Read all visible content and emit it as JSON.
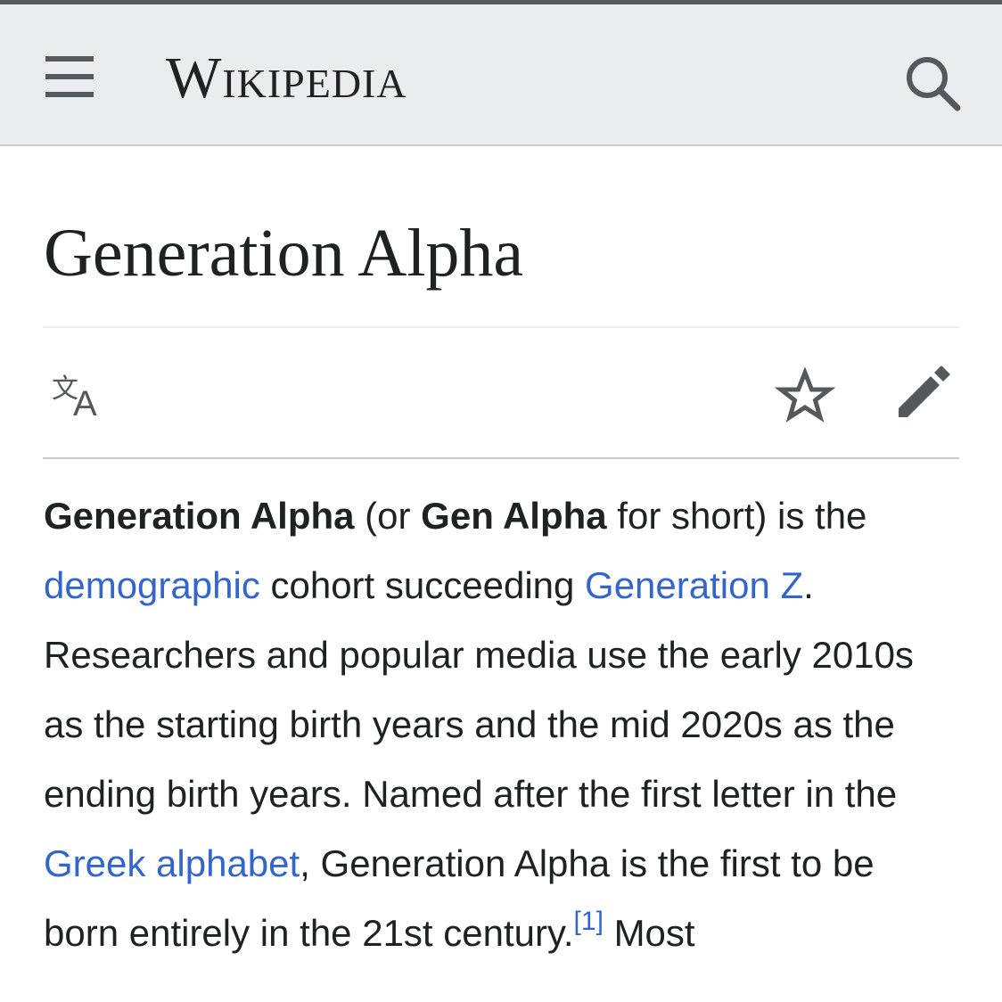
{
  "header": {
    "menu_icon": "hamburger-menu-icon",
    "wordmark": "Wikipedia",
    "search_icon": "search-icon"
  },
  "page": {
    "title": "Generation Alpha",
    "actions": {
      "language_icon": "language-icon",
      "watch_icon": "star-icon",
      "edit_icon": "pencil-icon"
    }
  },
  "article": {
    "segments": [
      {
        "type": "bold",
        "text": "Generation Alpha"
      },
      {
        "type": "text",
        "text": " (or "
      },
      {
        "type": "bold",
        "text": "Gen Alpha"
      },
      {
        "type": "text",
        "text": " for short) is the "
      },
      {
        "type": "link",
        "text": "demographic"
      },
      {
        "type": "text",
        "text": " cohort succeeding "
      },
      {
        "type": "link",
        "text": "Generation Z"
      },
      {
        "type": "text",
        "text": ". Researchers and popular media use the early 2010s as the starting birth years and the mid 2020s as the ending birth years. Named after the first letter in the "
      },
      {
        "type": "link",
        "text": "Greek alphabet"
      },
      {
        "type": "text",
        "text": ", Generation Alpha is the first to be born entirely in the 21st century."
      },
      {
        "type": "ref",
        "text": "[1]"
      },
      {
        "type": "text",
        "text": " Most"
      }
    ]
  },
  "colors": {
    "link": "#3366cc",
    "text": "#202122",
    "header_bg": "#eaecf0",
    "icon": "#54595d"
  }
}
